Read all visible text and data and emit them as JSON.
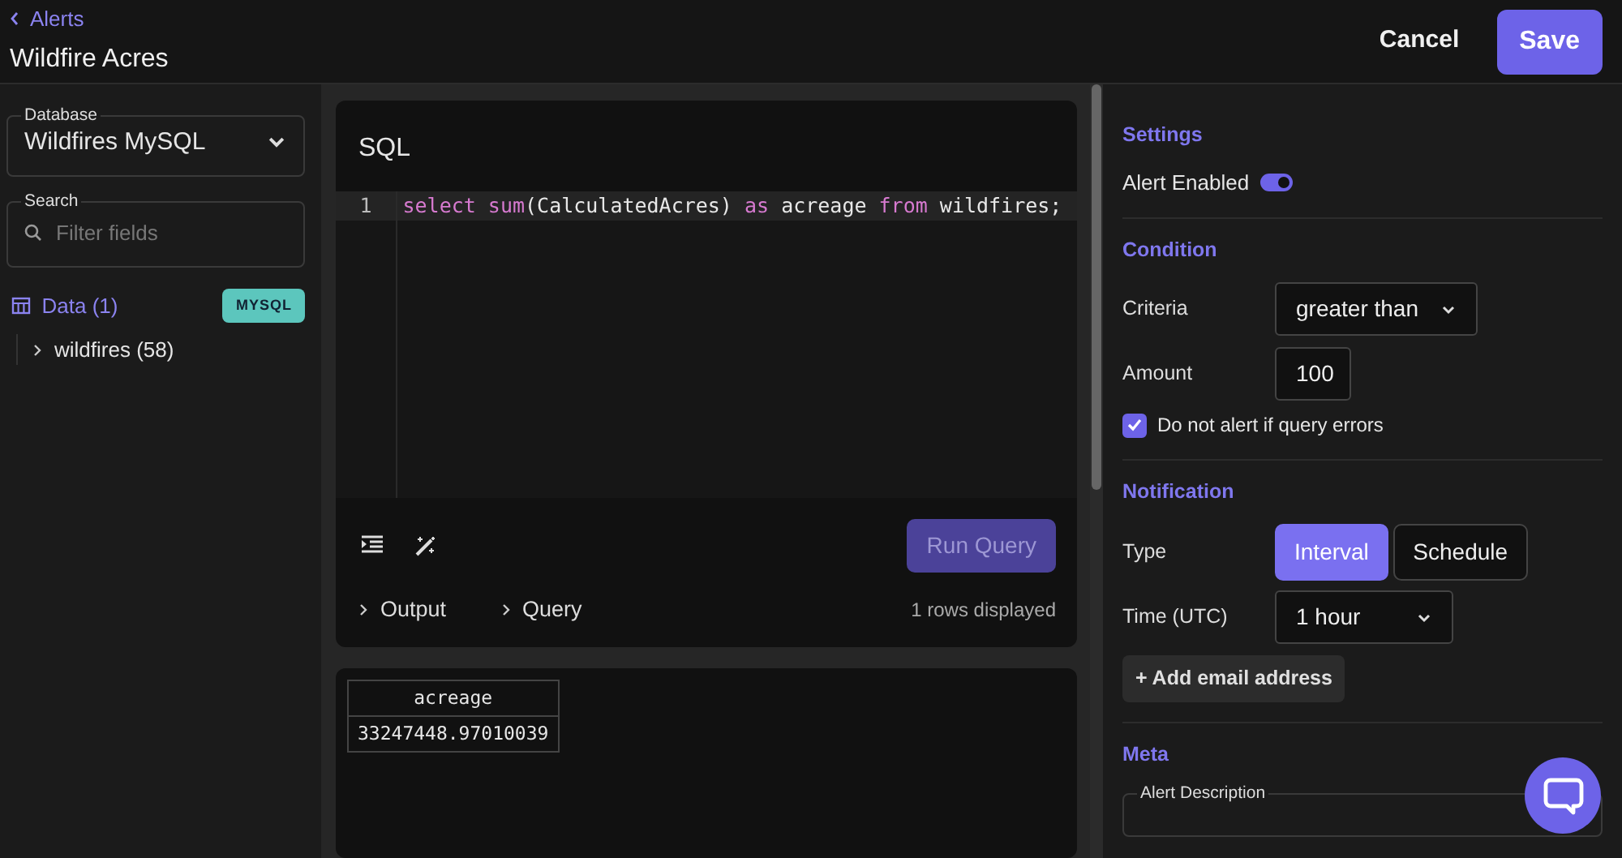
{
  "header": {
    "back_link": "Alerts",
    "title": "Wildfire Acres",
    "buttons": [
      {
        "label": "Cancel",
        "kind": "text"
      },
      {
        "label": "Save",
        "kind": "primary"
      }
    ]
  },
  "sidebar": {
    "database": {
      "label": "Database",
      "value": "Wildfires MySQL"
    },
    "search": {
      "label": "Search",
      "placeholder": "Filter fields"
    },
    "data": {
      "label": "Data (1)",
      "badge": "MYSQL",
      "children": [
        {
          "label": "wildfires (58)",
          "expanded": false
        }
      ]
    }
  },
  "editor": {
    "title": "SQL",
    "lines": [
      {
        "number": "1",
        "tokens": [
          {
            "text": "select",
            "kind": "keyword"
          },
          {
            "text": " sum",
            "kind": "keyword"
          },
          {
            "text": "(CalculatedAcres) ",
            "kind": "plain"
          },
          {
            "text": "as",
            "kind": "keyword"
          },
          {
            "text": " acreage ",
            "kind": "plain"
          },
          {
            "text": "from",
            "kind": "keyword"
          },
          {
            "text": " wildfires;",
            "kind": "plain"
          }
        ]
      }
    ],
    "run_button": {
      "label": "Run Query",
      "disabled": true
    },
    "sections": [
      {
        "label": "Output",
        "expanded": false
      },
      {
        "label": "Query",
        "expanded": false
      }
    ],
    "rows_info": "1 rows displayed"
  },
  "results": {
    "columns": [
      "acreage"
    ],
    "rows": [
      [
        "33247448.97010039"
      ]
    ]
  },
  "settings": [
    {
      "heading": "Settings",
      "fields": [
        {
          "kind": "toggle",
          "label": "Alert Enabled",
          "on": true
        }
      ]
    },
    {
      "heading": "Condition",
      "fields": [
        {
          "kind": "select",
          "label": "Criteria",
          "value": "greater than"
        },
        {
          "kind": "input",
          "label": "Amount",
          "value": "100"
        },
        {
          "kind": "checkbox",
          "label": "Do not alert if query errors",
          "checked": true
        }
      ]
    },
    {
      "heading": "Notification",
      "fields": [
        {
          "kind": "segmented",
          "label": "Type",
          "options": [
            {
              "label": "Interval",
              "selected": true
            },
            {
              "label": "Schedule",
              "selected": false
            }
          ]
        },
        {
          "kind": "select",
          "label": "Time (UTC)",
          "value": "1 hour"
        },
        {
          "kind": "button",
          "label": "+ Add email address"
        }
      ]
    },
    {
      "heading": "Meta",
      "fields": [
        {
          "kind": "textarea",
          "label": "Alert Description"
        }
      ]
    }
  ]
}
